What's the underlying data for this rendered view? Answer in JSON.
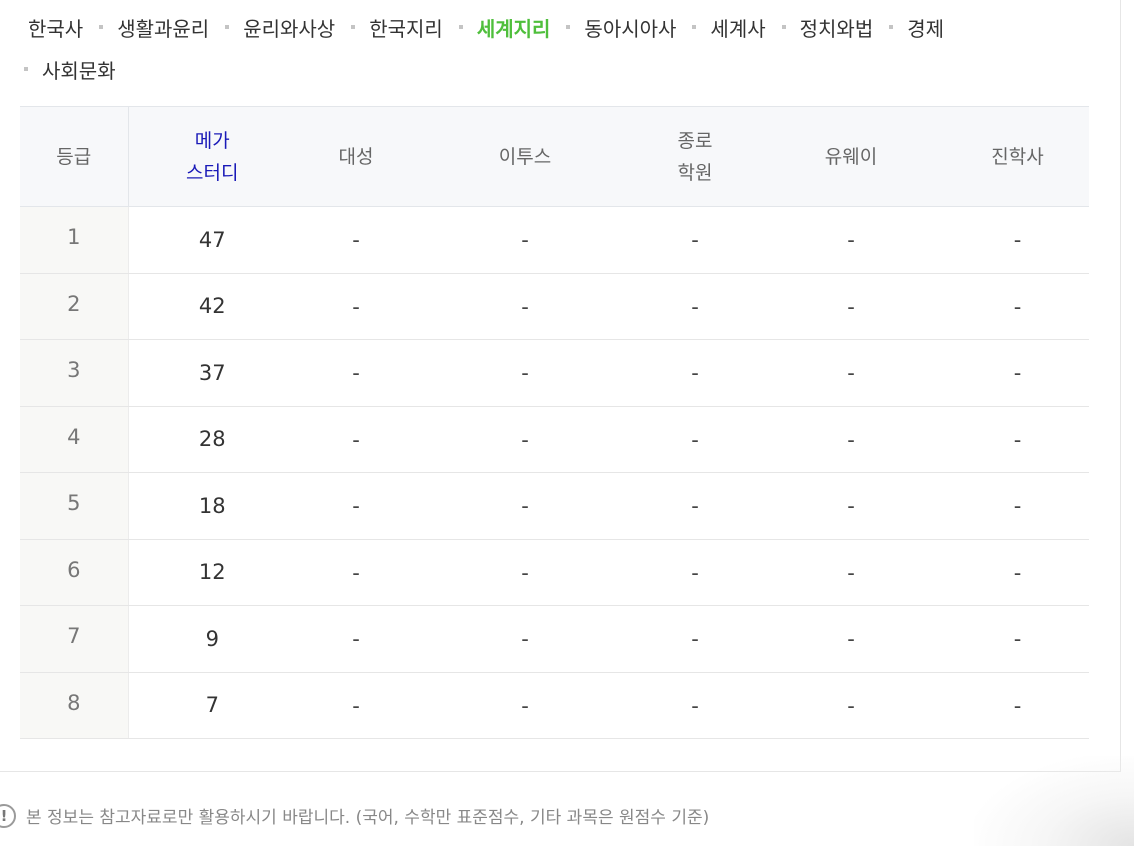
{
  "tabs": {
    "row1": [
      {
        "label": "한국사",
        "active": false
      },
      {
        "label": "생활과윤리",
        "active": false
      },
      {
        "label": "윤리와사상",
        "active": false
      },
      {
        "label": "한국지리",
        "active": false
      },
      {
        "label": "세계지리",
        "active": true
      },
      {
        "label": "동아시아사",
        "active": false
      },
      {
        "label": "세계사",
        "active": false
      },
      {
        "label": "정치와법",
        "active": false
      },
      {
        "label": "경제",
        "active": false
      }
    ],
    "row2": [
      {
        "label": "사회문화",
        "active": false
      }
    ]
  },
  "table": {
    "headers": {
      "grade": "등급",
      "mega_line1": "메가",
      "mega_line2": "스터디",
      "daesung": "대성",
      "etoos": "이투스",
      "jongro_line1": "종로",
      "jongro_line2": "학원",
      "uway": "유웨이",
      "jinhak": "진학사"
    },
    "rows": [
      {
        "grade": "1",
        "mega": "47",
        "daesung": "-",
        "etoos": "-",
        "jongro": "-",
        "uway": "-",
        "jinhak": "-"
      },
      {
        "grade": "2",
        "mega": "42",
        "daesung": "-",
        "etoos": "-",
        "jongro": "-",
        "uway": "-",
        "jinhak": "-"
      },
      {
        "grade": "3",
        "mega": "37",
        "daesung": "-",
        "etoos": "-",
        "jongro": "-",
        "uway": "-",
        "jinhak": "-"
      },
      {
        "grade": "4",
        "mega": "28",
        "daesung": "-",
        "etoos": "-",
        "jongro": "-",
        "uway": "-",
        "jinhak": "-"
      },
      {
        "grade": "5",
        "mega": "18",
        "daesung": "-",
        "etoos": "-",
        "jongro": "-",
        "uway": "-",
        "jinhak": "-"
      },
      {
        "grade": "6",
        "mega": "12",
        "daesung": "-",
        "etoos": "-",
        "jongro": "-",
        "uway": "-",
        "jinhak": "-"
      },
      {
        "grade": "7",
        "mega": "9",
        "daesung": "-",
        "etoos": "-",
        "jongro": "-",
        "uway": "-",
        "jinhak": "-"
      },
      {
        "grade": "8",
        "mega": "7",
        "daesung": "-",
        "etoos": "-",
        "jongro": "-",
        "uway": "-",
        "jinhak": "-"
      }
    ]
  },
  "notice": {
    "icon": "exclamation-circle-icon",
    "text": "본 정보는 참고자료로만 활용하시기 바랍니다. (국어, 수학만 표준점수, 기타 과목은 원점수 기준)"
  },
  "colors": {
    "active_tab": "#4fbf3c",
    "highlight_header": "#1a1ab8",
    "header_bg": "#f7f8fa",
    "grade_cell_bg": "#f8f8f6"
  }
}
